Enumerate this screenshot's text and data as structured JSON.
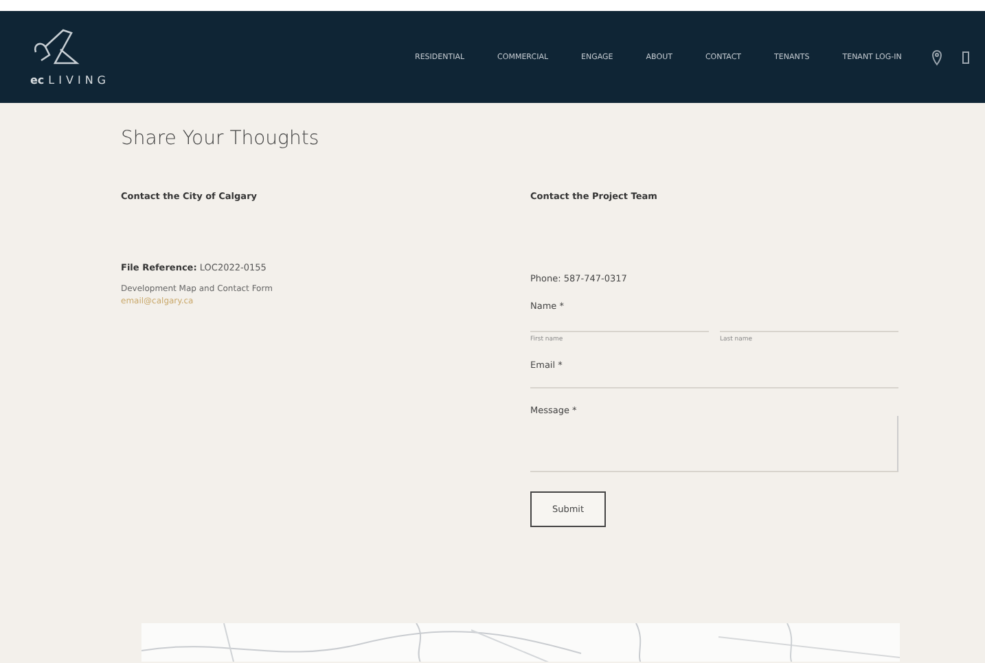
{
  "header": {
    "brand": "LIVING",
    "brand_mark": "ec",
    "nav": [
      {
        "label": "RESIDENTIAL"
      },
      {
        "label": "COMMERCIAL"
      },
      {
        "label": "ENGAGE"
      },
      {
        "label": "ABOUT"
      },
      {
        "label": "CONTACT"
      },
      {
        "label": "TENANTS"
      },
      {
        "label": "TENANT LOG-IN"
      }
    ]
  },
  "title": "Share Your Thoughts",
  "city": {
    "heading": "Contact the City of Calgary",
    "file_label": "File Reference:",
    "file_value": "LOC2022-0155",
    "text": "Development Map and Contact Form",
    "link": "email@calgary.ca"
  },
  "project": {
    "heading": "Contact the Project Team",
    "phone": "Phone: 587-747-0317",
    "form": {
      "name_label": "Name *",
      "first_hint": "First name",
      "last_hint": "Last name",
      "email_label": "Email *",
      "message_label": "Message *",
      "submit": "Submit"
    }
  }
}
